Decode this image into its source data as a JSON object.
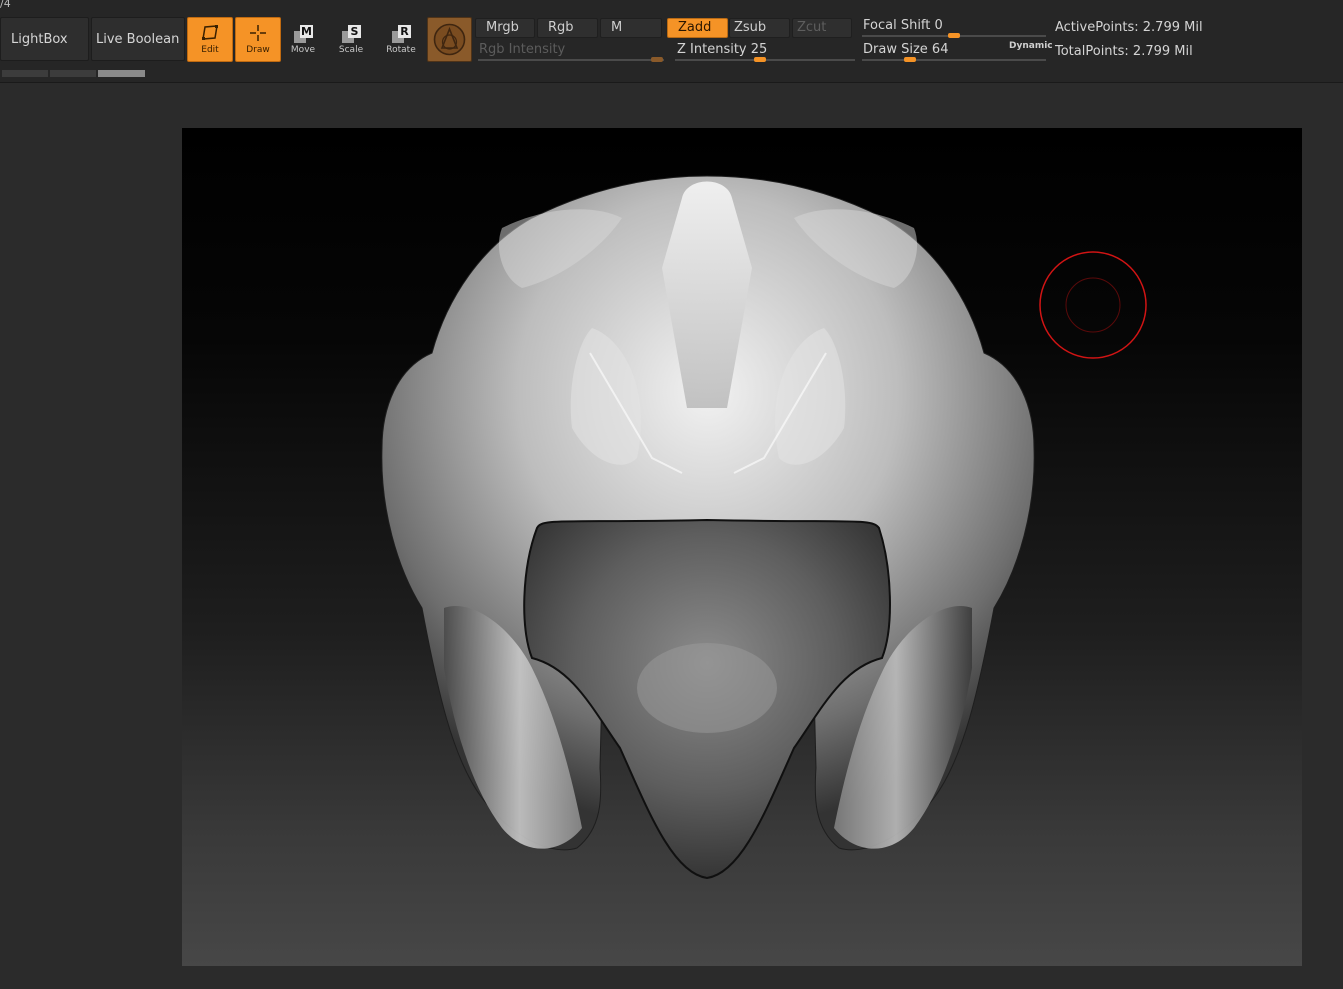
{
  "corner_label": "/4",
  "buttons": {
    "lightbox": "LightBox",
    "live_boolean": "Live Boolean"
  },
  "tools": {
    "edit": "Edit",
    "draw": "Draw",
    "move": "Move",
    "move_key": "M",
    "scale": "Scale",
    "scale_key": "S",
    "rotate": "Rotate",
    "rotate_key": "R"
  },
  "color_modes": {
    "mrgb": "Mrgb",
    "rgb": "Rgb",
    "m": "M"
  },
  "sculpt_modes": {
    "zadd": "Zadd",
    "zsub": "Zsub",
    "zcut": "Zcut"
  },
  "sliders": {
    "rgb_intensity_label": "Rgb Intensity",
    "z_intensity_label": "Z Intensity",
    "z_intensity_value": "25",
    "focal_shift_label": "Focal Shift",
    "focal_shift_value": "0",
    "draw_size_label": "Draw Size",
    "draw_size_value": "64",
    "dynamic": "Dynamic"
  },
  "stats": {
    "active_points": "ActivePoints: 2.799 Mil",
    "total_points": "TotalPoints: 2.799 Mil"
  },
  "colors": {
    "accent": "#f59326",
    "brush_ring": "#d11414"
  }
}
